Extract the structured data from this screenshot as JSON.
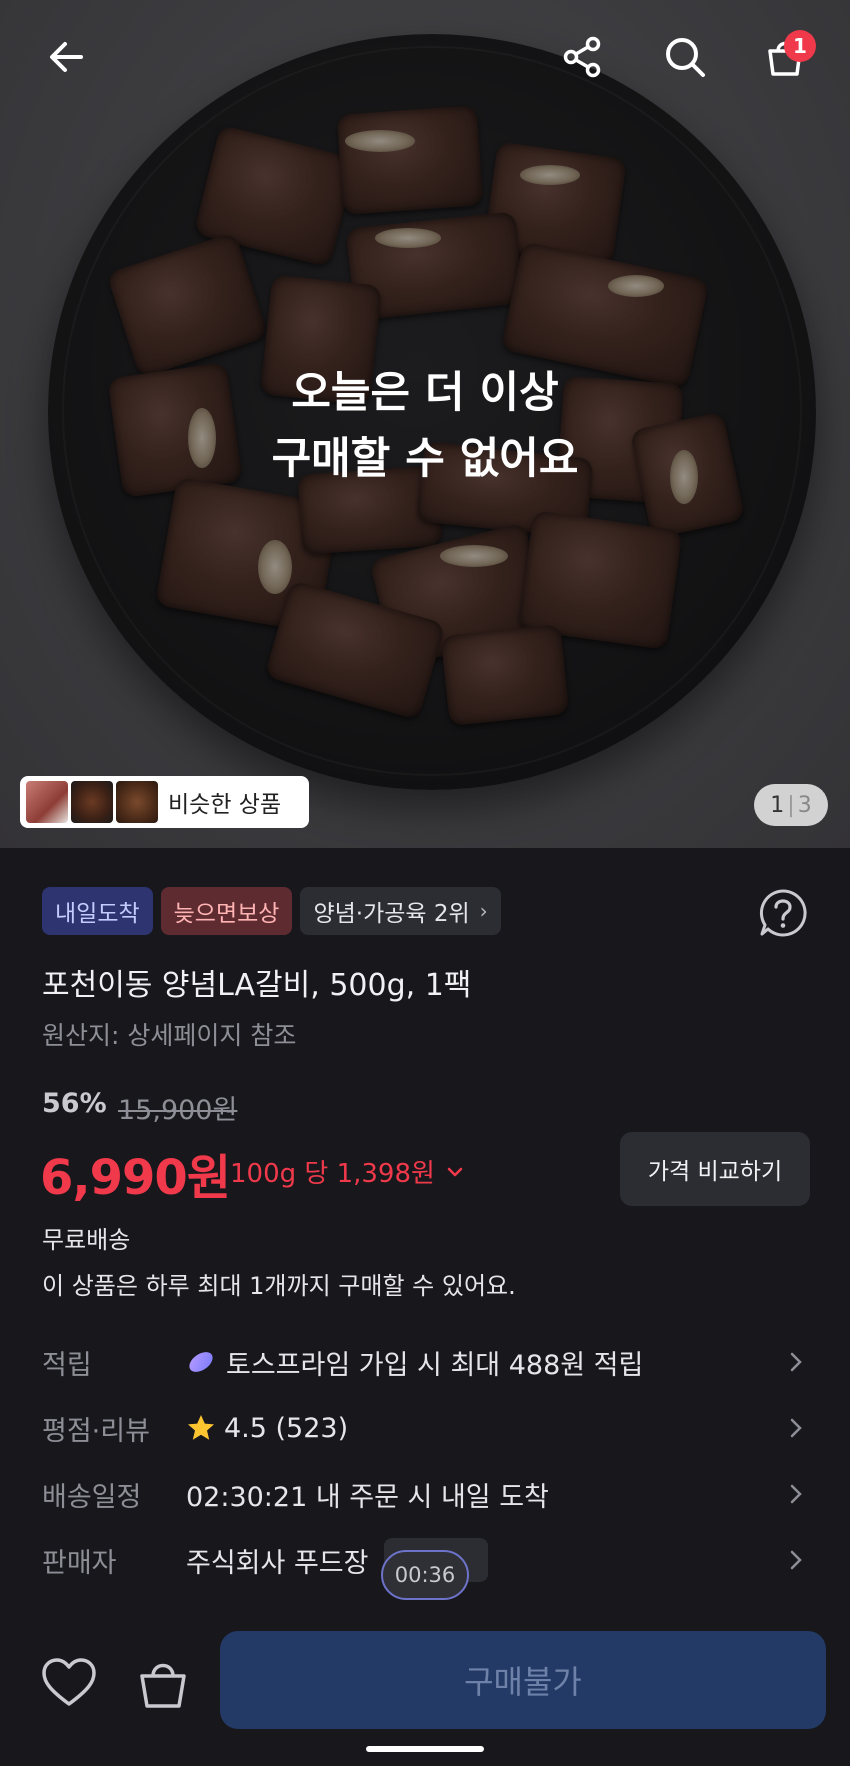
{
  "hero": {
    "soldout_line1": "오늘은 더 이상",
    "soldout_line2": "구매할 수 없어요",
    "similar_label": "비슷한 상품",
    "pager_current": "1",
    "pager_separator": "|",
    "pager_total": "3"
  },
  "topbar": {
    "back_icon": "arrow-left-icon",
    "share_icon": "share-icon",
    "search_icon": "search-icon",
    "cart_icon": "shopping-bag-icon",
    "cart_count": "1"
  },
  "badges": {
    "arrive": "내일도착",
    "late_comp": "늦으면보상",
    "rank": "양념·가공육 2위",
    "rank_chevron": "›"
  },
  "product": {
    "title": "포천이동 양념LA갈비, 500g, 1팩",
    "origin": "원산지: 상세페이지 참조",
    "discount": "56%",
    "original_price": "15,900원",
    "price": "6,990원",
    "unit_price": "100g 당 1,398원",
    "unit_price_chevron": "⌄",
    "compare_button": "가격 비교하기",
    "shipping_free": "무료배송",
    "purchase_limit": "이 상품은 하루 최대 1개까지 구매할 수 있어요."
  },
  "details": [
    {
      "label": "적립",
      "value": "토스프라임 가입 시 최대 488원 적립"
    },
    {
      "label": "평점·리뷰",
      "value": "4.5 (523)"
    },
    {
      "label": "배송일정",
      "value": "02:30:21 내 주문 시 내일 도착"
    },
    {
      "label": "판매자",
      "value": "주식회사 푸드장"
    }
  ],
  "timer": "00:36",
  "bottom": {
    "buy_button": "구매불가"
  },
  "colors": {
    "accent_red": "#f0394a",
    "background": "#17171c",
    "buy_disabled": "#233a66"
  }
}
